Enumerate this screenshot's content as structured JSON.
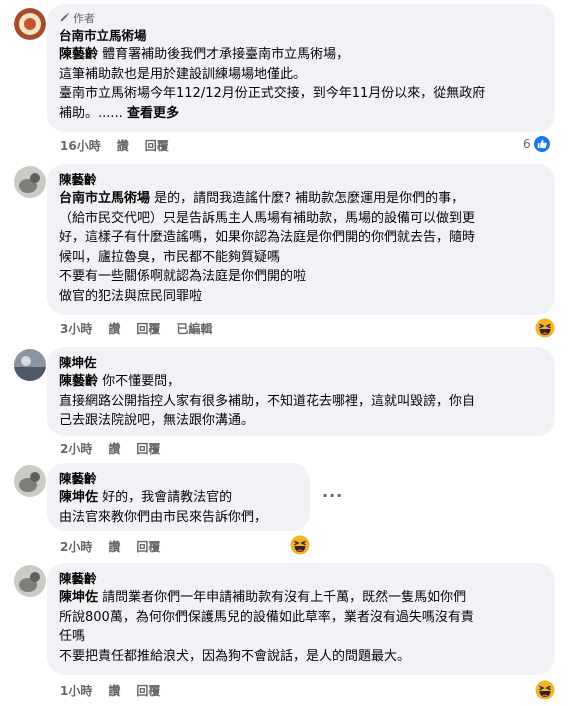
{
  "comments": [
    {
      "author_tag": "作者",
      "name": "台南市立馬術場",
      "mention": "陳藝齡",
      "lines": [
        " 體育署補助後我們才承接臺南市立馬術場，",
        "這筆補助款也是用於建設訓練場場地僅此。",
        "臺南市立馬術場今年112/12月份正式交接，到今年11月份以來，從無政府",
        "補助。...... "
      ],
      "see_more": "查看更多",
      "time": "16小時",
      "like": "讚",
      "reply": "回覆",
      "reaction_count": "6"
    },
    {
      "name": "陳藝齡",
      "mention": "台南市立馬術場",
      "lines": [
        " 是的，請問我造謠什麼? 補助款怎麼運用是你們的事，",
        "（給市民交代吧）只是告訴馬主人馬場有補助款，馬場的設備可以做到更",
        "好，這樣子有什麼造謠嗎，如果你認為法庭是你們開的你們就去告，隨時",
        "候叫，廬拉魯臭，市民都不能夠質疑嗎",
        "不要有一些關係啊就認為法庭是你們開的啦",
        "做官的犯法與庶民同罪啦"
      ],
      "time": "3小時",
      "like": "讚",
      "reply": "回覆",
      "edited": "已編輯"
    },
    {
      "name": "陳坤佐",
      "mention": "陳藝齡",
      "lines": [
        " 你不懂要問，",
        "直接網路公開指控人家有很多補助，不知道花去哪裡，這就叫毀謗，你自",
        "己去跟法院說吧，無法跟你溝通。"
      ],
      "time": "2小時",
      "like": "讚",
      "reply": "回覆"
    },
    {
      "name": "陳藝齡",
      "mention": "陳坤佐",
      "lines": [
        " 好的，我會請教法官的",
        "由法官來教你們由市民來告訴你們，"
      ],
      "time": "2小時",
      "like": "讚",
      "reply": "回覆",
      "more_options": "···"
    },
    {
      "name": "陳藝齡",
      "mention": "陳坤佐",
      "lines": [
        " 請問業者你們一年申請補助款有沒有上千萬，既然一隻馬如你們",
        "所說800萬，為何你們保護馬兒的設備如此草率，業者沒有過失嗎沒有責",
        "任嗎",
        "不要把責任都推給浪犬，因為狗不會說話，是人的問題最大。"
      ],
      "time": "1小時",
      "like": "讚",
      "reply": "回覆"
    }
  ],
  "colors": {
    "bubble": "#f0f2f5",
    "meta": "#65676b",
    "like_blue": "#1877f2"
  }
}
